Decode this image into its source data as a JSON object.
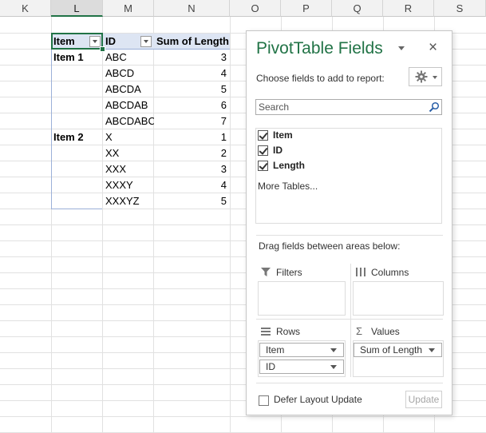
{
  "columns": [
    "K",
    "L",
    "M",
    "N",
    "O",
    "P",
    "Q",
    "R",
    "S"
  ],
  "pivot": {
    "headers": {
      "item": "Item",
      "id": "ID",
      "sum": "Sum of Length"
    },
    "rows": [
      {
        "item": "Item 1",
        "id": "ABC",
        "len": "3"
      },
      {
        "item": "",
        "id": "ABCD",
        "len": "4"
      },
      {
        "item": "",
        "id": "ABCDA",
        "len": "5"
      },
      {
        "item": "",
        "id": "ABCDAB",
        "len": "6"
      },
      {
        "item": "",
        "id": "ABCDABC",
        "len": "7"
      },
      {
        "item": "Item 2",
        "id": "X",
        "len": "1"
      },
      {
        "item": "",
        "id": "XX",
        "len": "2"
      },
      {
        "item": "",
        "id": "XXX",
        "len": "3"
      },
      {
        "item": "",
        "id": "XXXY",
        "len": "4"
      },
      {
        "item": "",
        "id": "XXXYZ",
        "len": "5"
      }
    ]
  },
  "pane": {
    "title": "PivotTable Fields",
    "close": "×",
    "choose_label": "Choose fields to add to report:",
    "search_placeholder": "Search",
    "fields": [
      {
        "label": "Item",
        "checked": true
      },
      {
        "label": "ID",
        "checked": true
      },
      {
        "label": "Length",
        "checked": true
      }
    ],
    "more_tables": "More Tables...",
    "drag_label": "Drag fields between areas below:",
    "areas": {
      "filters": {
        "label": "Filters",
        "items": []
      },
      "columns": {
        "label": "Columns",
        "items": []
      },
      "rows": {
        "label": "Rows",
        "items": [
          "Item",
          "ID"
        ]
      },
      "values": {
        "label": "Values",
        "items": [
          "Sum of Length"
        ]
      }
    },
    "defer_label": "Defer Layout Update",
    "update_label": "Update"
  },
  "colors": {
    "accent": "#217346",
    "header_fill": "#dde5f3"
  }
}
